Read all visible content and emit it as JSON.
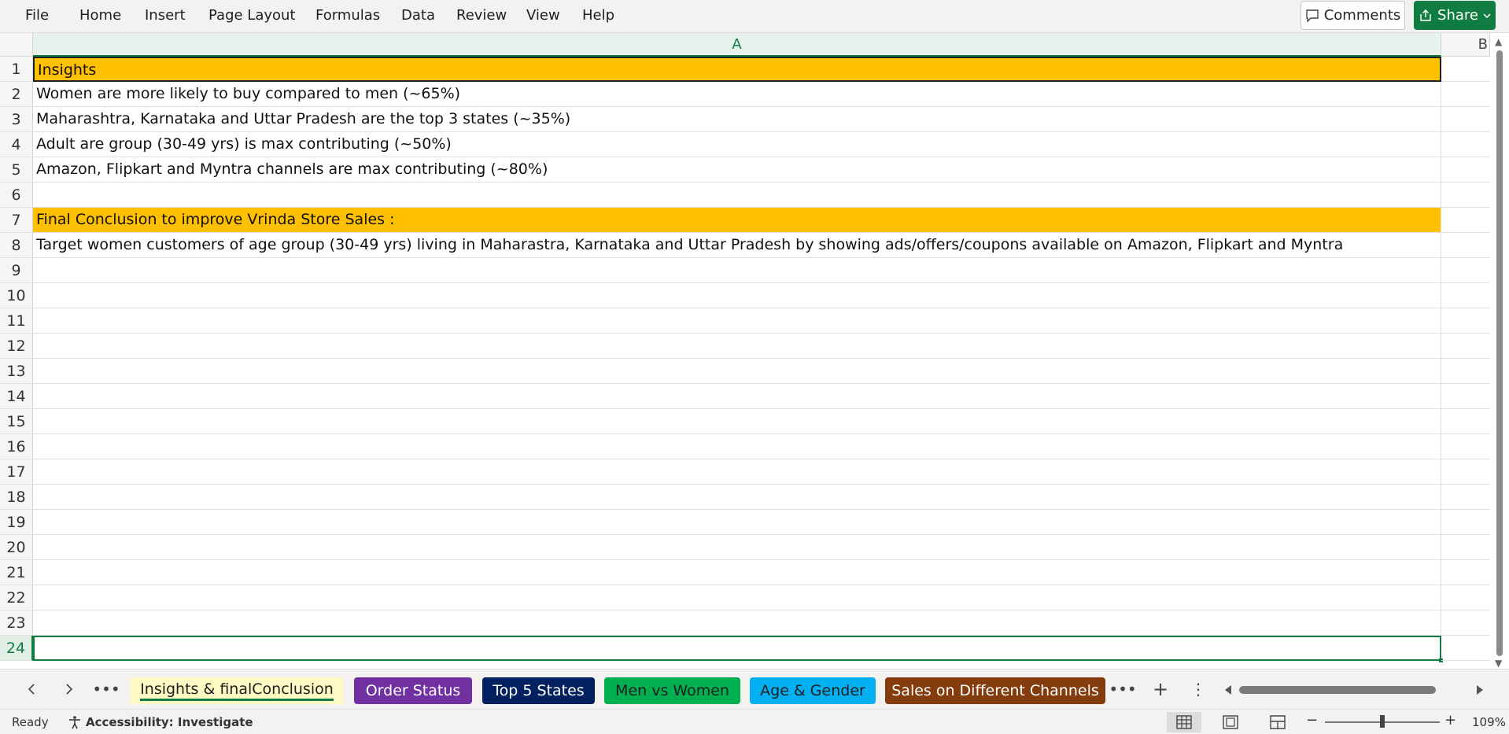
{
  "menu": {
    "items": [
      "File",
      "Home",
      "Insert",
      "Page Layout",
      "Formulas",
      "Data",
      "Review",
      "View",
      "Help"
    ],
    "comments_label": "Comments",
    "share_label": "Share"
  },
  "grid": {
    "columns": [
      "A",
      "B"
    ],
    "active_column": "A",
    "selected_row": "24",
    "rows": [
      {
        "num": "1",
        "text": "Insights"
      },
      {
        "num": "2",
        "text": "Women are more likely to buy compared to men (~65%)"
      },
      {
        "num": "3",
        "text": "Maharashtra, Karnataka and Uttar Pradesh are the top 3 states (~35%)"
      },
      {
        "num": "4",
        "text": "Adult are group (30-49 yrs) is max contributing (~50%)"
      },
      {
        "num": "5",
        "text": "Amazon, Flipkart and Myntra channels are max contributing (~80%)"
      },
      {
        "num": "6",
        "text": ""
      },
      {
        "num": "7",
        "text": "Final Conclusion to improve Vrinda Store Sales :"
      },
      {
        "num": "8",
        "text": "Target women customers of age group (30-49 yrs) living in Maharastra, Karnataka and Uttar Pradesh by showing ads/offers/coupons available on Amazon, Flipkart and Myntra"
      },
      {
        "num": "9",
        "text": ""
      },
      {
        "num": "10",
        "text": ""
      },
      {
        "num": "11",
        "text": ""
      },
      {
        "num": "12",
        "text": ""
      },
      {
        "num": "13",
        "text": ""
      },
      {
        "num": "14",
        "text": ""
      },
      {
        "num": "15",
        "text": ""
      },
      {
        "num": "16",
        "text": ""
      },
      {
        "num": "17",
        "text": ""
      },
      {
        "num": "18",
        "text": ""
      },
      {
        "num": "19",
        "text": ""
      },
      {
        "num": "20",
        "text": ""
      },
      {
        "num": "21",
        "text": ""
      },
      {
        "num": "22",
        "text": ""
      },
      {
        "num": "23",
        "text": ""
      },
      {
        "num": "24",
        "text": ""
      }
    ],
    "highlight_color": "#ffc000"
  },
  "sheets": {
    "tabs": [
      {
        "label": "Insights & finalConclusion",
        "color": "#fff9c4",
        "text_color": "#1f1f1f",
        "active": true
      },
      {
        "label": "Order Status",
        "color": "#7030a0",
        "text_color": "#ffffff",
        "active": false
      },
      {
        "label": "Top 5 States",
        "color": "#002060",
        "text_color": "#ffffff",
        "active": false
      },
      {
        "label": "Men vs Women",
        "color": "#00b050",
        "text_color": "#1f1f1f",
        "active": false
      },
      {
        "label": "Age & Gender",
        "color": "#00b0f0",
        "text_color": "#1f1f1f",
        "active": false
      },
      {
        "label": "Sales on Different Channels",
        "color": "#843c0c",
        "text_color": "#ffffff",
        "active": false
      }
    ]
  },
  "status": {
    "ready": "Ready",
    "accessibility": "Accessibility: Investigate",
    "zoom": "109%"
  },
  "colors": {
    "accent": "#107c41"
  }
}
